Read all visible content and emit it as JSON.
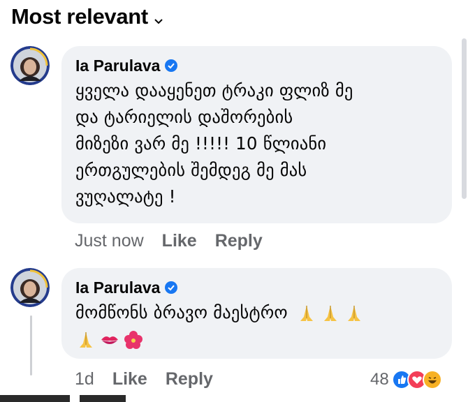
{
  "header": {
    "sort_label": "Most relevant"
  },
  "comments": [
    {
      "author": "Ia Parulava",
      "verified": true,
      "lines": [
        "ყველა დააყენეთ ტრაკი ფლიზ მე",
        "და ტარიელის დაშორების",
        "მიზეზი ვარ მე !!!!! 10 წლიანი",
        "ერთგულების შემდეგ მე მას",
        "ვუღალატე !"
      ],
      "time": "Just now",
      "like_label": "Like",
      "reply_label": "Reply"
    },
    {
      "author": "Ia Parulava",
      "verified": true,
      "lines": [
        "მომწონს ბრავო მაესტრო"
      ],
      "emojis": [
        "folded-hands",
        "folded-hands",
        "folded-hands",
        "folded-hands",
        "kiss-mark",
        "hibiscus"
      ],
      "time": "1d",
      "like_label": "Like",
      "reply_label": "Reply",
      "reaction_count": "48",
      "reactions": [
        "like",
        "love",
        "haha"
      ]
    }
  ],
  "colors": {
    "bubble": "#f0f2f5",
    "meta_text": "#65676b",
    "verified": "#1877f2"
  }
}
